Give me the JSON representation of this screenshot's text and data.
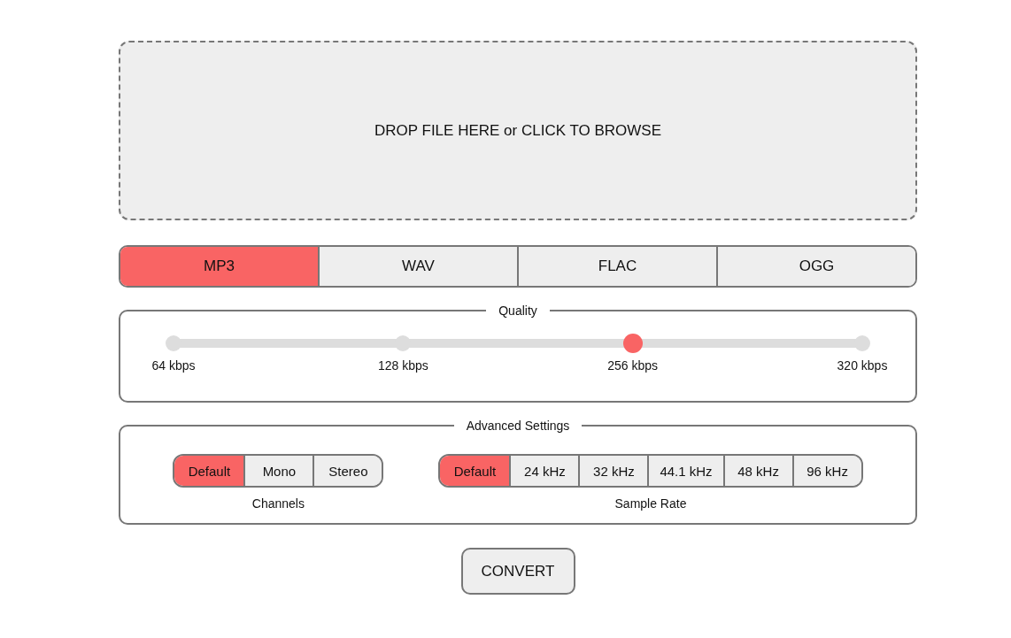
{
  "dropzone": {
    "text": "DROP FILE HERE or CLICK TO BROWSE"
  },
  "formats": [
    {
      "label": "MP3",
      "selected": true
    },
    {
      "label": "WAV",
      "selected": false
    },
    {
      "label": "FLAC",
      "selected": false
    },
    {
      "label": "OGG",
      "selected": false
    }
  ],
  "quality": {
    "legend": "Quality",
    "options": [
      {
        "label": "64 kbps",
        "selected": false
      },
      {
        "label": "128 kbps",
        "selected": false
      },
      {
        "label": "256 kbps",
        "selected": true
      },
      {
        "label": "320 kbps",
        "selected": false
      }
    ]
  },
  "advanced": {
    "legend": "Advanced Settings",
    "groups": [
      {
        "label": "Channels",
        "options": [
          {
            "label": "Default",
            "selected": true
          },
          {
            "label": "Mono",
            "selected": false
          },
          {
            "label": "Stereo",
            "selected": false
          }
        ]
      },
      {
        "label": "Sample Rate",
        "options": [
          {
            "label": "Default",
            "selected": true
          },
          {
            "label": "24 kHz",
            "selected": false
          },
          {
            "label": "32 kHz",
            "selected": false
          },
          {
            "label": "44.1 kHz",
            "selected": false
          },
          {
            "label": "48 kHz",
            "selected": false
          },
          {
            "label": "96 kHz",
            "selected": false
          }
        ]
      }
    ]
  },
  "convert": "CONVERT"
}
